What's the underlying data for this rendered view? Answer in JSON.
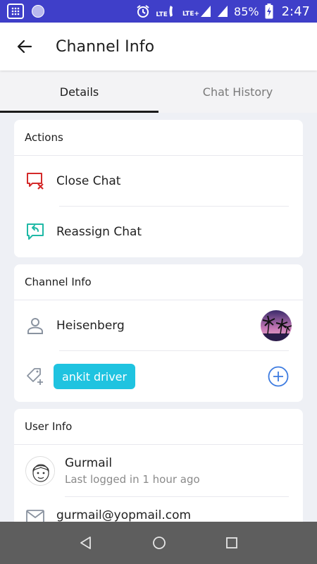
{
  "status_bar": {
    "network_label": "LTE",
    "network2_label": "LTE+",
    "battery": "85%",
    "time": "2:47"
  },
  "app_bar": {
    "title": "Channel Info"
  },
  "tabs": [
    {
      "label": "Details",
      "active": true
    },
    {
      "label": "Chat History",
      "active": false
    }
  ],
  "actions": {
    "header": "Actions",
    "items": [
      {
        "label": "Close Chat",
        "icon": "close-chat-icon"
      },
      {
        "label": "Reassign Chat",
        "icon": "reassign-chat-icon"
      }
    ]
  },
  "channel_info": {
    "header": "Channel Info",
    "contact_name": "Heisenberg",
    "tag": "ankit driver"
  },
  "user_info": {
    "header": "User Info",
    "name": "Gurmail",
    "last_seen": "Last logged in 1 hour ago",
    "email": "gurmail@yopmail.com"
  },
  "colors": {
    "status_bar": "#3f3fc9",
    "close_icon": "#d42a2a",
    "reassign_icon": "#1fb9a6",
    "tag_chip": "#1fc3e0",
    "add_button": "#3d7be0",
    "nav_bar": "#5e5e5e"
  }
}
